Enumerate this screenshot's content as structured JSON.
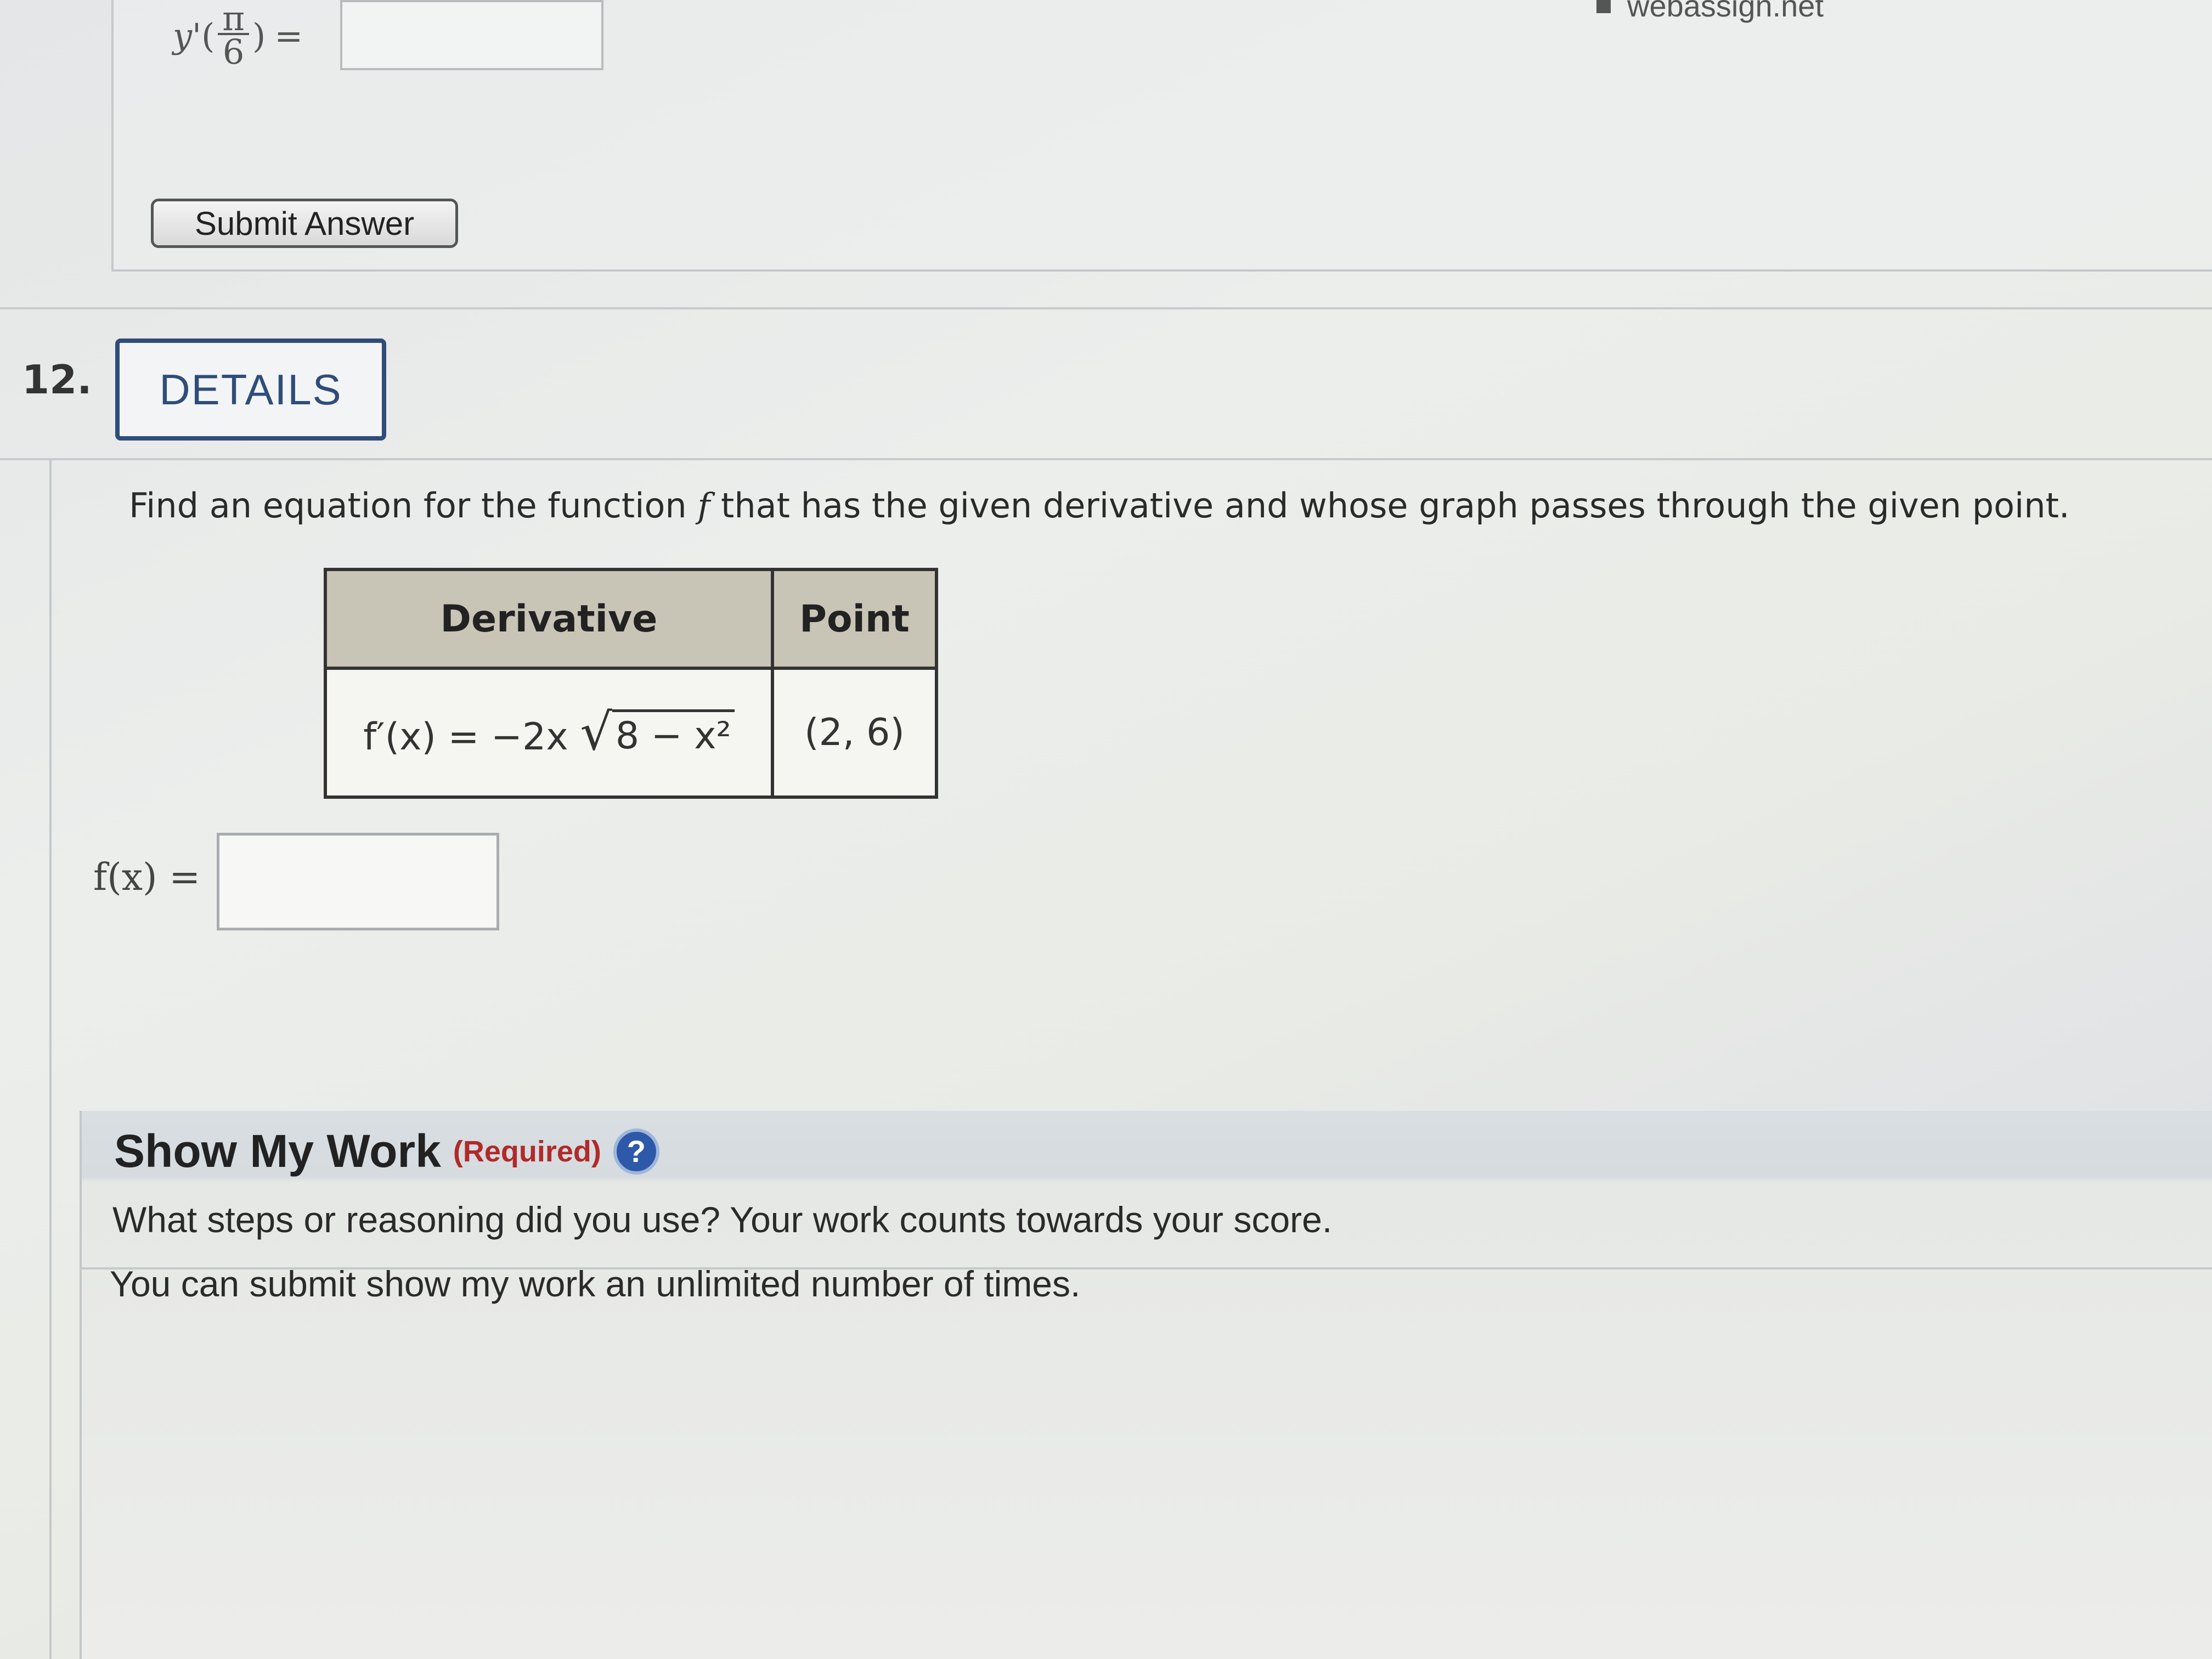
{
  "header": {
    "source_site": "webassign.net"
  },
  "previous_question": {
    "equation_lhs": "y'",
    "fraction_numerator": "π",
    "fraction_denominator": "6",
    "equals": "=",
    "answer_value": "",
    "submit_label": "Submit Answer"
  },
  "question": {
    "number": "12.",
    "details_label": "DETAILS",
    "prompt_before": "Find an equation for the function ",
    "prompt_var": "f",
    "prompt_after": " that has the given derivative and whose graph passes through the given point.",
    "table": {
      "headers": [
        "Derivative",
        "Point"
      ],
      "derivative_prefix": "f′(x) = −2x",
      "derivative_radicand": "8 − x²",
      "point": "(2, 6)"
    },
    "answer_label": "f(x) =",
    "answer_value": ""
  },
  "show_my_work": {
    "title": "Show My Work",
    "required": "(Required)",
    "help_icon": "question-circle-icon",
    "help_glyph": "?",
    "line1": "What steps or reasoning did you use? Your work counts towards your score.",
    "line2": "You can submit show my work an unlimited number of times."
  },
  "colors": {
    "details_border": "#2f4d7a",
    "table_header_bg": "#c9c5b6",
    "required_red": "#b12a2a",
    "help_blue": "#2d59a8"
  }
}
